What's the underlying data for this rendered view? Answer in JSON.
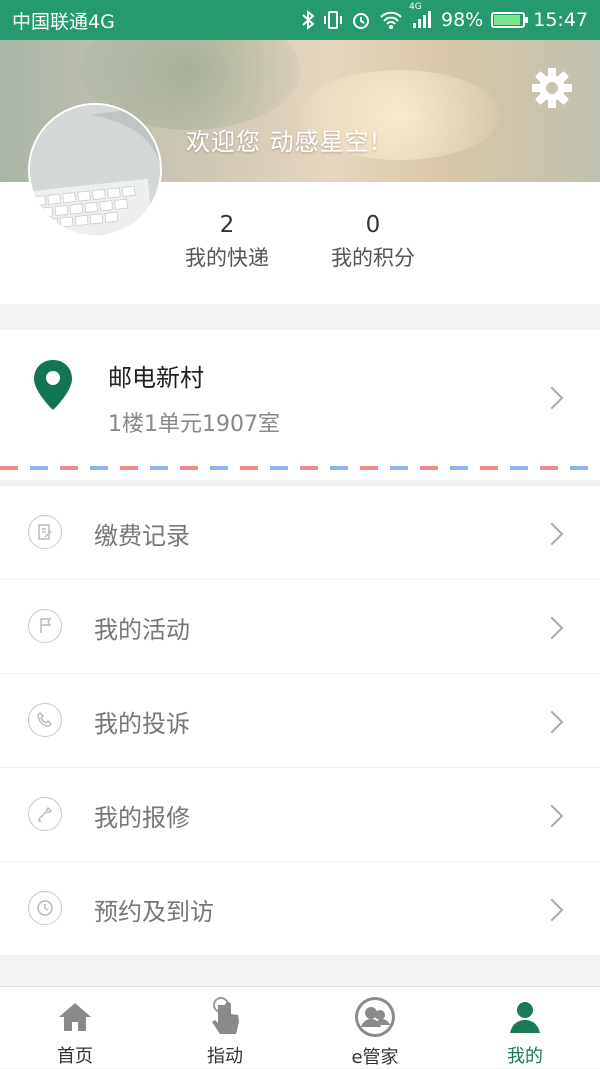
{
  "status_bar": {
    "carrier": "中国联通4G",
    "network_tag": "4G",
    "battery": "98%",
    "battery_level": 0.98,
    "time": "15:47",
    "icons": [
      "bluetooth-icon",
      "vibrate-icon",
      "alarm-icon",
      "wifi-icon",
      "signal-icon",
      "battery-icon"
    ]
  },
  "header": {
    "welcome": "欢迎您  动感星空!",
    "settings_icon": "gear-icon"
  },
  "profile": {
    "stats": [
      {
        "value": "2",
        "label": "我的快递"
      },
      {
        "value": "0",
        "label": "我的积分"
      }
    ]
  },
  "address": {
    "title": "邮电新村",
    "detail": "1楼1单元1907室",
    "icon": "location-pin-icon"
  },
  "menu": [
    {
      "label": "缴费记录",
      "icon": "payment-record-icon"
    },
    {
      "label": "我的活动",
      "icon": "flag-icon"
    },
    {
      "label": "我的投诉",
      "icon": "phone-icon"
    },
    {
      "label": "我的报修",
      "icon": "repair-icon"
    },
    {
      "label": "预约及到访",
      "icon": "clock-icon"
    }
  ],
  "tabbar": [
    {
      "label": "首页",
      "icon": "home-icon",
      "active": false
    },
    {
      "label": "指动",
      "icon": "touch-icon",
      "active": false
    },
    {
      "label": "e管家",
      "icon": "butler-icon",
      "active": false
    },
    {
      "label": "我的",
      "icon": "person-icon",
      "active": true
    }
  ],
  "colors": {
    "status_bar": "#249a6e",
    "accent": "#1a7a55",
    "pin": "#127551"
  }
}
